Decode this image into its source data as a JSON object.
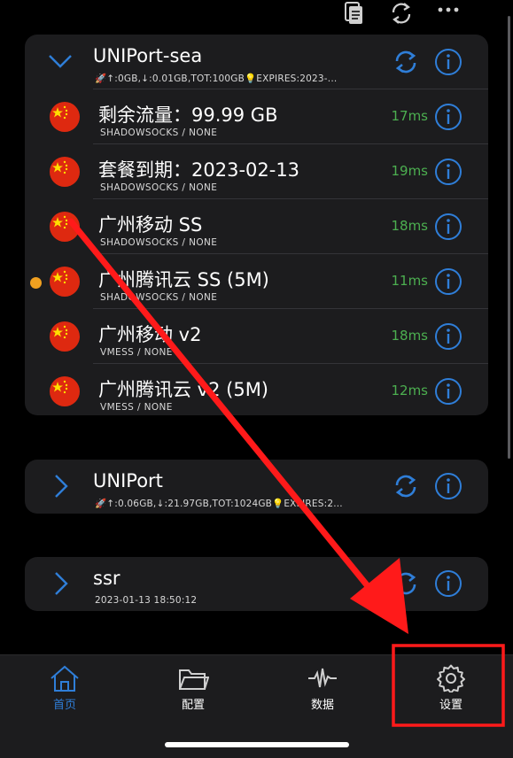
{
  "colors": {
    "accent": "#2f7ed8",
    "latency": "#4caf50",
    "active_dot": "#f0a020",
    "annotation": "#ff0000"
  },
  "toolbar": {
    "icons": [
      "clipboard-icon",
      "refresh-icon",
      "more-icon"
    ]
  },
  "groups": [
    {
      "title": "UNIPort-sea",
      "subtitle": "🚀↑:0GB,↓:0.01GB,TOT:100GB💡EXPIRES:2023-...",
      "expanded": true,
      "nodes": [
        {
          "name": "剩余流量：99.99 GB",
          "type": "SHADOWSOCKS / NONE",
          "latency": "17ms",
          "active": false
        },
        {
          "name": "套餐到期：2023-02-13",
          "type": "SHADOWSOCKS / NONE",
          "latency": "19ms",
          "active": false
        },
        {
          "name": "广州移动 SS",
          "type": "SHADOWSOCKS / NONE",
          "latency": "18ms",
          "active": false
        },
        {
          "name": "广州腾讯云 SS (5M)",
          "type": "SHADOWSOCKS / NONE",
          "latency": "11ms",
          "active": true
        },
        {
          "name": "广州移动 v2",
          "type": "VMESS / NONE",
          "latency": "18ms",
          "active": false
        },
        {
          "name": "广州腾讯云 v2 (5M)",
          "type": "VMESS / NONE",
          "latency": "12ms",
          "active": false
        }
      ]
    },
    {
      "title": "UNIPort",
      "subtitle": "🚀↑:0.06GB,↓:21.97GB,TOT:1024GB💡EXPIRES:2...",
      "expanded": false
    },
    {
      "title": "ssr",
      "subtitle": "2023-01-13 18:50:12",
      "expanded": false
    }
  ],
  "tabs": [
    {
      "label": "首页",
      "icon": "home-icon",
      "active": true
    },
    {
      "label": "配置",
      "icon": "folder-icon",
      "active": false
    },
    {
      "label": "数据",
      "icon": "activity-icon",
      "active": false
    },
    {
      "label": "设置",
      "icon": "gear-icon",
      "active": false
    }
  ],
  "annotation": {
    "type": "arrow-and-box",
    "target": "tab-settings"
  }
}
